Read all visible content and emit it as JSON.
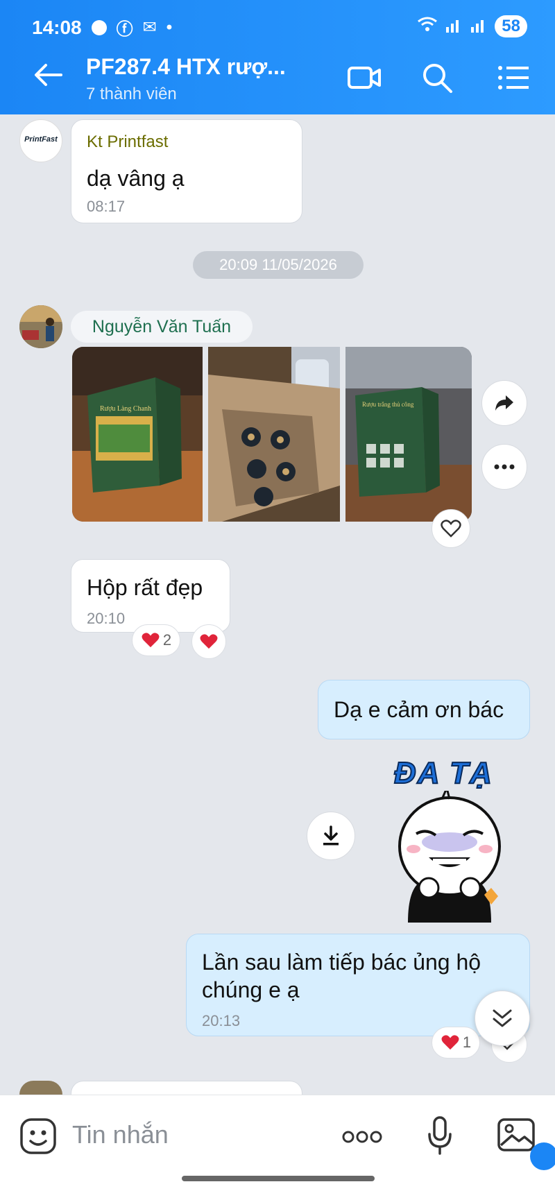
{
  "status_bar": {
    "time": "14:08",
    "battery": "58"
  },
  "header": {
    "title": "PF287.4 HTX rượ...",
    "subtitle": "7 thành viên"
  },
  "messages": {
    "m1": {
      "sender": "Kt Printfast",
      "avatar_text": "PrintFast",
      "text": "dạ vâng ạ",
      "time": "08:17"
    },
    "date_separator": "20:09 11/05/2026",
    "m2": {
      "sender": "Nguyễn Văn Tuấn"
    },
    "m3": {
      "text": "Hộp rất đẹp",
      "time": "20:10",
      "reaction_count": "2"
    },
    "m4": {
      "text": "Dạ e cảm ơn bác"
    },
    "sticker": {
      "text": "ĐA TẠ"
    },
    "m5": {
      "line1": "Lần sau làm tiếp bác ủng hộ",
      "line2": "chúng e ạ",
      "time": "20:13",
      "reaction_count": "1"
    }
  },
  "photos": {
    "p1": {
      "brand": "Rượu Làng Chanh"
    },
    "p3": {
      "brand": "Rượu trắng thủ công"
    }
  },
  "composer": {
    "placeholder": "Tin nhắn"
  },
  "colors": {
    "header": "#2196f3",
    "my_bubble": "#d7eefe",
    "reaction_heart": "#e0243a"
  }
}
